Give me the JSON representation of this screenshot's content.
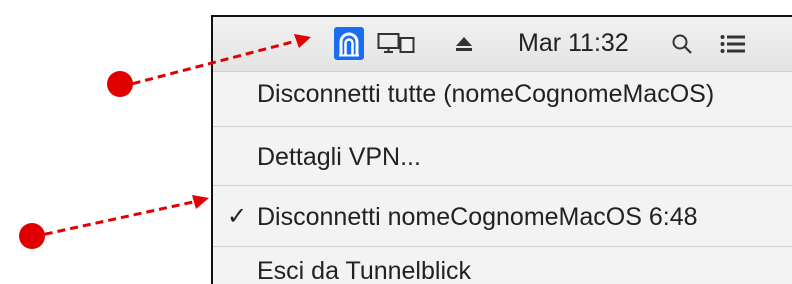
{
  "menubar": {
    "icons": [
      "tunnelblick-icon",
      "display-mirroring-icon",
      "eject-icon",
      "spotlight-search-icon",
      "notification-center-icon"
    ],
    "clock": "Mar 11:32",
    "accent_color": "#1a6cf0"
  },
  "menu": {
    "items": [
      {
        "label": "Disconnetti tutte (nomeCognomeMacOS)",
        "checked": false
      },
      {
        "label": "Dettagli VPN...",
        "checked": false
      },
      {
        "label": "Disconnetti nomeCognomeMacOS 6:48",
        "checked": true
      },
      {
        "label": "Esci da Tunnelblick",
        "checked": false
      }
    ],
    "check_glyph": "✓"
  },
  "annotations": {
    "color": "#e00000"
  }
}
